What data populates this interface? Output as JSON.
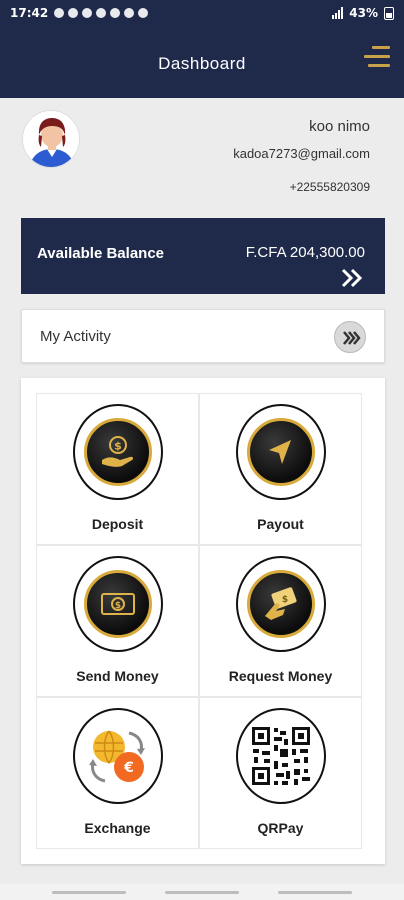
{
  "status_bar": {
    "time": "17:42",
    "battery": "43%"
  },
  "app_bar": {
    "title": "Dashboard"
  },
  "profile": {
    "name": "koo nimo",
    "email": "kadoa7273@gmail.com",
    "phone": "+22555820309"
  },
  "balance": {
    "label": "Available Balance",
    "amount": "F.CFA 204,300.00"
  },
  "activity": {
    "label": "My Activity"
  },
  "actions": [
    {
      "label": "Deposit",
      "icon": "deposit-coin-icon"
    },
    {
      "label": "Payout",
      "icon": "payout-send-icon"
    },
    {
      "label": "Send Money",
      "icon": "send-money-icon"
    },
    {
      "label": "Request Money",
      "icon": "request-money-icon"
    },
    {
      "label": "Exchange",
      "icon": "exchange-globe-icon"
    },
    {
      "label": "QRPay",
      "icon": "qr-code-icon"
    }
  ],
  "colors": {
    "primary": "#1f2a4b",
    "accent": "#c9a14a",
    "background": "#ececec"
  }
}
